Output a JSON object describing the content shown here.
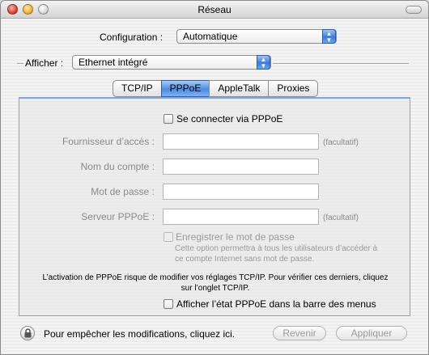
{
  "window": {
    "title": "Réseau"
  },
  "config": {
    "label": "Configuration :",
    "value": "Automatique"
  },
  "show": {
    "label": "Afficher :",
    "value": "Ethernet intégré"
  },
  "tabs": [
    {
      "label": "TCP/IP",
      "selected": false
    },
    {
      "label": "PPPoE",
      "selected": true
    },
    {
      "label": "AppleTalk",
      "selected": false
    },
    {
      "label": "Proxies",
      "selected": false
    }
  ],
  "pppoe": {
    "connect_label": "Se connecter via PPPoE",
    "fields": [
      {
        "label": "Fournisseur d’accès :",
        "value": "",
        "optional": "(facultatif)"
      },
      {
        "label": "Nom du compte :",
        "value": ""
      },
      {
        "label": "Mot de passe :",
        "value": ""
      },
      {
        "label": "Serveur PPPoE :",
        "value": "",
        "optional": "(facultatif)"
      }
    ],
    "save_password_label": "Enregistrer le mot de passe",
    "save_password_help_1": "Cette option permettra à tous les utilisateurs d’accéder à",
    "save_password_help_2": "ce compte Internet sans mot de passe.",
    "warning_1": "L’activation de PPPoE risque de modifier vos réglages TCP/IP. Pour vérifier ces derniers, cliquez",
    "warning_2": "sur l’onglet TCP/IP.",
    "menu_status_label": "Afficher l’état PPPoE dans la barre des menus"
  },
  "footer": {
    "lock_text": "Pour empêcher les modifications, cliquez ici.",
    "revert_label": "Revenir",
    "apply_label": "Appliquer"
  }
}
